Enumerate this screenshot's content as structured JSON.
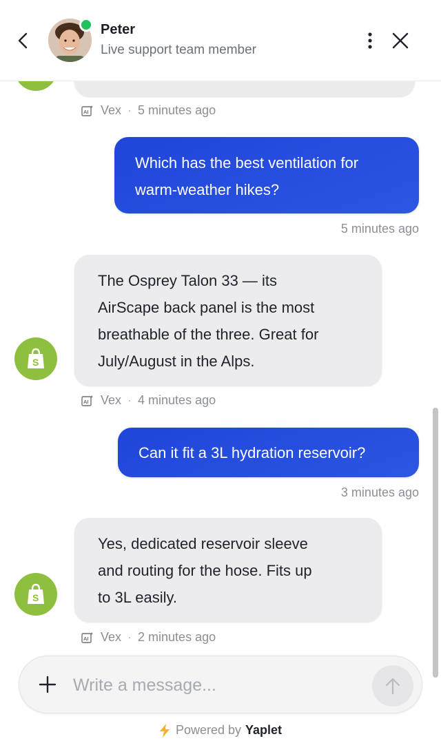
{
  "header": {
    "agent_name": "Peter",
    "agent_role": "Live support team member",
    "online_color": "#1ec35a"
  },
  "messages": [
    {
      "sender": "bot",
      "author": "Vex",
      "time": "5 minutes ago",
      "text": ""
    },
    {
      "sender": "user",
      "time": "5 minutes ago",
      "lines": [
        "Which has the best ventilation for",
        "warm-weather hikes?"
      ]
    },
    {
      "sender": "bot",
      "author": "Vex",
      "time": "4 minutes ago",
      "lines": [
        "The Osprey Talon 33 — its",
        "AirScape back panel is the most",
        "breathable of the three. Great for",
        "July/August in the Alps."
      ]
    },
    {
      "sender": "user",
      "time": "3 minutes ago",
      "lines": [
        "Can it fit a 3L hydration reservoir?"
      ]
    },
    {
      "sender": "bot",
      "author": "Vex",
      "time": "2 minutes ago",
      "lines": [
        "Yes, dedicated reservoir sleeve",
        "and routing for the hose. Fits up",
        "to 3L easily."
      ]
    }
  ],
  "composer": {
    "placeholder": "Write a message..."
  },
  "footer": {
    "powered_by": "Powered by",
    "brand": "Yaplet"
  },
  "colors": {
    "user_bubble": "#2149dd",
    "bot_bubble": "#ececee",
    "shop_avatar": "#8fbf3f"
  }
}
